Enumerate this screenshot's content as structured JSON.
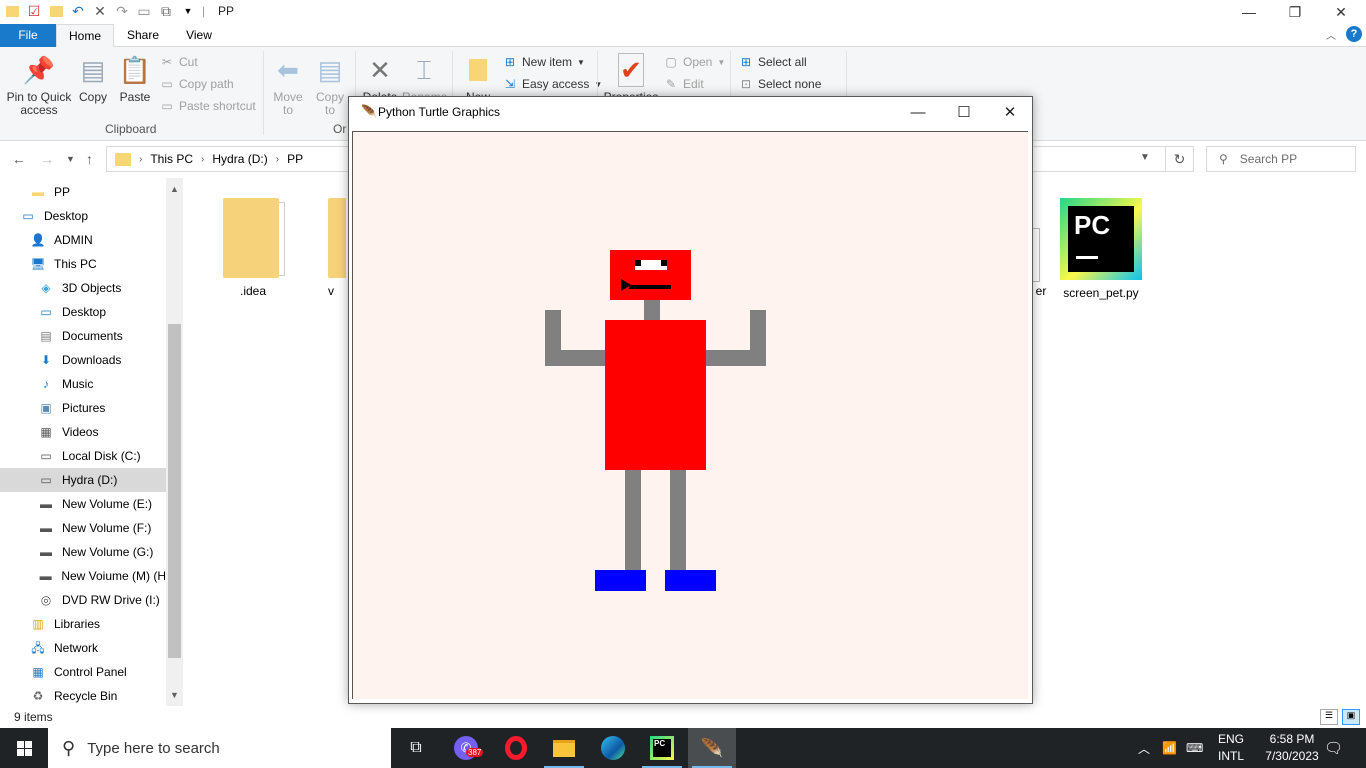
{
  "explorer": {
    "window_title": "PP",
    "tabs": [
      "File",
      "Home",
      "Share",
      "View"
    ],
    "ribbon": {
      "pin_label": "Pin to Quick access",
      "copy_label": "Copy",
      "paste_label": "Paste",
      "cut_label": "Cut",
      "copy_path_label": "Copy path",
      "paste_shortcut_label": "Paste shortcut",
      "clipboard_group": "Clipboard",
      "move_to_label": "Move to",
      "copy_to_label": "Copy to",
      "organize_group_partial": "Or",
      "delete_label": "Delete",
      "rename_label": "Rename",
      "new_folder_label": "New",
      "new_item_label": "New item",
      "easy_access_label": "Easy access",
      "properties_label": "Properties",
      "open_label": "Open",
      "edit_label": "Edit",
      "select_all_label": "Select all",
      "select_none_label": "Select none"
    },
    "address": {
      "crumbs": [
        "This PC",
        "Hydra (D:)",
        "PP"
      ],
      "search_placeholder": "Search PP"
    },
    "nav": {
      "items": [
        {
          "label": "PP",
          "icon": "folder-icon"
        },
        {
          "label": "Desktop",
          "icon": "desktop-icon"
        },
        {
          "label": "ADMIN",
          "icon": "user-icon"
        },
        {
          "label": "This PC",
          "icon": "computer-icon"
        },
        {
          "label": "3D Objects",
          "icon": "cube-icon"
        },
        {
          "label": "Desktop",
          "icon": "desktop-icon"
        },
        {
          "label": "Documents",
          "icon": "document-icon"
        },
        {
          "label": "Downloads",
          "icon": "download-icon"
        },
        {
          "label": "Music",
          "icon": "music-icon"
        },
        {
          "label": "Pictures",
          "icon": "picture-icon"
        },
        {
          "label": "Videos",
          "icon": "video-icon"
        },
        {
          "label": "Local Disk (C:)",
          "icon": "disk-icon"
        },
        {
          "label": "Hydra (D:)",
          "icon": "disk-icon"
        },
        {
          "label": "New Volume (E:)",
          "icon": "drive-icon"
        },
        {
          "label": "New Volume (F:)",
          "icon": "drive-icon"
        },
        {
          "label": "New Volume (G:)",
          "icon": "drive-icon"
        },
        {
          "label": "New Voiume (M) (H",
          "icon": "drive-icon"
        },
        {
          "label": "DVD RW Drive (I:)",
          "icon": "dvd-icon"
        },
        {
          "label": "Libraries",
          "icon": "library-icon"
        },
        {
          "label": "Network",
          "icon": "network-icon"
        },
        {
          "label": "Control Panel",
          "icon": "control-panel-icon"
        },
        {
          "label": "Recycle Bin",
          "icon": "recycle-bin-icon"
        }
      ],
      "selected": "Hydra (D:)"
    },
    "files": [
      {
        "name": ".idea",
        "icon": "folder-icon"
      },
      {
        "name": "v",
        "icon": "folder-icon"
      },
      {
        "name": "er",
        "icon": "file-icon"
      },
      {
        "name": "screen_pet.py",
        "icon": "pycharm-icon"
      }
    ],
    "status": {
      "item_count": "9 items"
    }
  },
  "turtle_window": {
    "title": "Python Turtle Graphics",
    "background": "#fff3ef",
    "robot_colors": {
      "head": "#ff0000",
      "body": "#ff0000",
      "limbs": "#808080",
      "feet": "#0000ff",
      "eyes": "#ffffff",
      "mouth": "#000000"
    }
  },
  "taskbar": {
    "search_placeholder": "Type here to search",
    "viber_badge": "387",
    "language": {
      "top": "ENG",
      "bottom": "INTL"
    },
    "clock": {
      "time": "6:58 PM",
      "date": "7/30/2023"
    }
  }
}
